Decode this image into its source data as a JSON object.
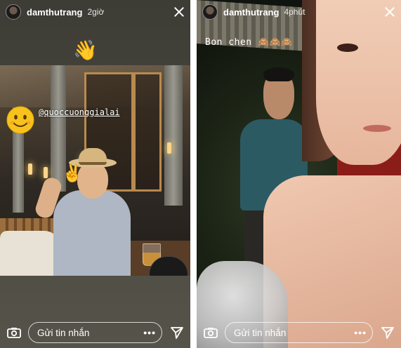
{
  "stories": [
    {
      "username": "damthutrang",
      "time": "2giờ",
      "mention": "@quoccuonggialai",
      "stickers": [
        "waving-hand-emoji",
        "smiling-face-emoji"
      ]
    },
    {
      "username": "damthutrang",
      "time": "4phút",
      "caption": "Bon chen",
      "caption_emoji": "🙈🙈🙈"
    }
  ],
  "footer": {
    "message_placeholder": "Gửi tin nhắn",
    "more_label": "•••"
  },
  "icons": {
    "close": "close-icon",
    "camera": "camera-icon",
    "send": "send-icon"
  },
  "colors": {
    "text": "#ffffff",
    "smile_emoji": "#f7c21b"
  }
}
